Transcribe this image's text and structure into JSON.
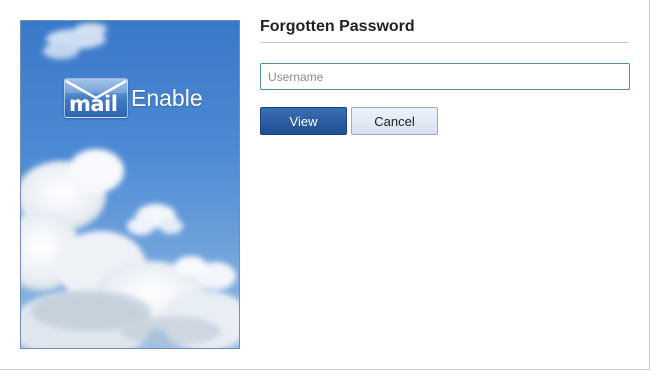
{
  "brand": {
    "logo_mail": "mail",
    "logo_enable": "Enable"
  },
  "form": {
    "title": "Forgotten Password",
    "username_placeholder": "Username",
    "username_value": "",
    "view_label": "View",
    "cancel_label": "Cancel"
  },
  "colors": {
    "primary_button": "#1f4f93",
    "secondary_button": "#d5e1ef",
    "input_border": "#4f8fa6",
    "sky": "#4d8ad4"
  }
}
